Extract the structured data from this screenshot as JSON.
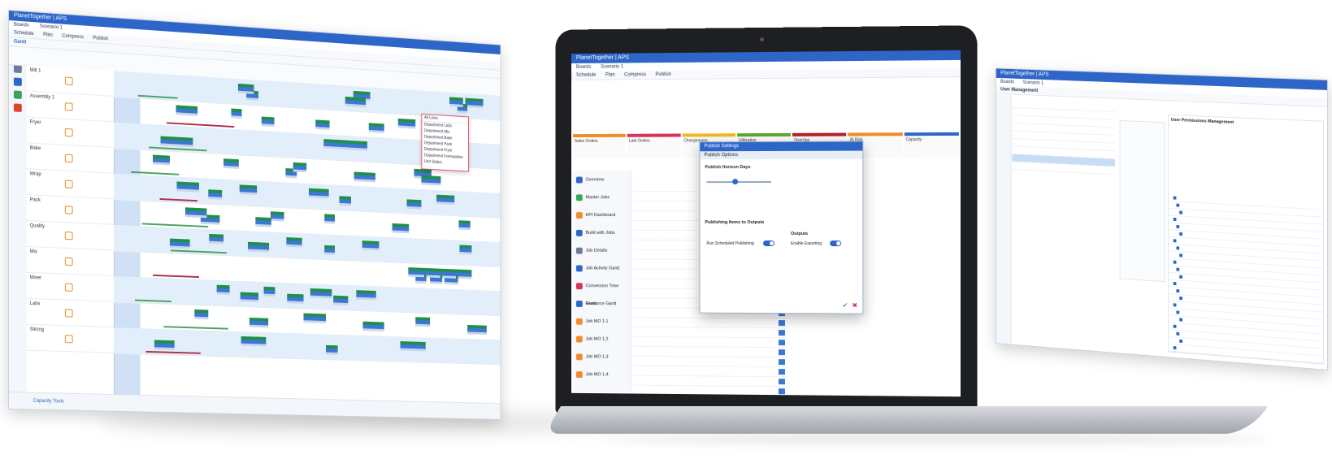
{
  "left_window": {
    "title": "PlanetTogether | APS",
    "menu": [
      "Boards",
      "Scenario 1"
    ],
    "toolbar": [
      "Schedule",
      "Plan",
      "Compress",
      "Publish"
    ],
    "tab_label": "Gantt",
    "resources": [
      "Mill 1",
      "Assembly 1",
      "Fryer",
      "Bake",
      "Wrap",
      "Pack",
      "Quality",
      "Mix",
      "Mixer",
      "Labs",
      "Slicing"
    ],
    "dropdown_items": [
      "All Lines",
      "Department Labs",
      "Department Mix",
      "Department Bake",
      "Department Pack",
      "Department Fryer",
      "Department Formulation",
      "Unit Status"
    ],
    "status_link": "Capacity Tools"
  },
  "laptop": {
    "title": "PlanetTogether | APS",
    "menu": [
      "Boards",
      "Scenario 1"
    ],
    "toolbar": [
      "Schedule",
      "Plan",
      "Compress",
      "Publish"
    ],
    "categories": [
      {
        "label": "Sales Orders",
        "color": "#f28c28"
      },
      {
        "label": "Late Orders",
        "color": "#d8315b"
      },
      {
        "label": "Changeovers",
        "color": "#f2b822"
      },
      {
        "label": "Utilization",
        "color": "#5aa832"
      },
      {
        "label": "Overdue",
        "color": "#b5202e"
      },
      {
        "label": "At Risk",
        "color": "#f28c28"
      },
      {
        "label": "Capacity",
        "color": "#2d66c8"
      }
    ],
    "nav": [
      "Overview",
      "Master Jobs",
      "KPI Dashboard",
      "Build with Jobs",
      "Job Details",
      "Job Activity Gantt",
      "Conversion Time Gantt",
      "Resource Gantt",
      "Job MO 1.1",
      "Job MO 1.2",
      "Job MO 1.3",
      "Job MO 1.4"
    ],
    "dialog": {
      "title": "Publish Settings",
      "subtitle": "Publish Options",
      "section1": "Publish Horizon Days",
      "section2": "Publishing Items to Outputs",
      "section3": "Outputs",
      "label_toggle1": "Enable Exporting",
      "label_toggle2": "Run Scheduled Publishing"
    }
  },
  "right_window": {
    "title": "PlanetTogether | APS",
    "menu": [
      "Boards",
      "Scenario 1"
    ],
    "panel_title": "User Management",
    "right_panel_title": "User Permissions Management"
  }
}
